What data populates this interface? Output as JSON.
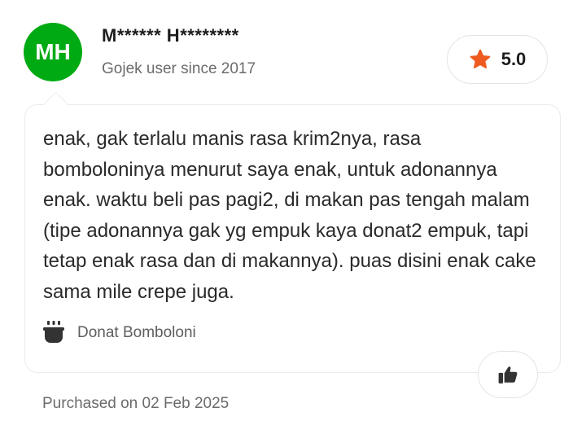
{
  "reviewer": {
    "initials": "MH",
    "name": "M****** H********",
    "since": "Gojek user since 2017",
    "avatar_color": "#00aa13"
  },
  "rating": {
    "value": "5.0",
    "icon": "star-icon",
    "star_color": "#ee5a1f"
  },
  "review": {
    "text": "enak, gak terlalu manis rasa krim2nya, rasa bomboloninya menurut saya enak, untuk adonannya enak. waktu beli pas pagi2, di makan pas tengah malam (tipe adonannya gak yg empuk kaya donat2 empuk, tapi tetap enak rasa dan di makannya). puas disini enak cake sama mile crepe juga.",
    "dish_icon": "dish-icon",
    "dish_name": "Donat Bomboloni"
  },
  "actions": {
    "like_icon": "thumbs-up-icon"
  },
  "footer": {
    "purchase_date": "Purchased on 02 Feb 2025"
  }
}
